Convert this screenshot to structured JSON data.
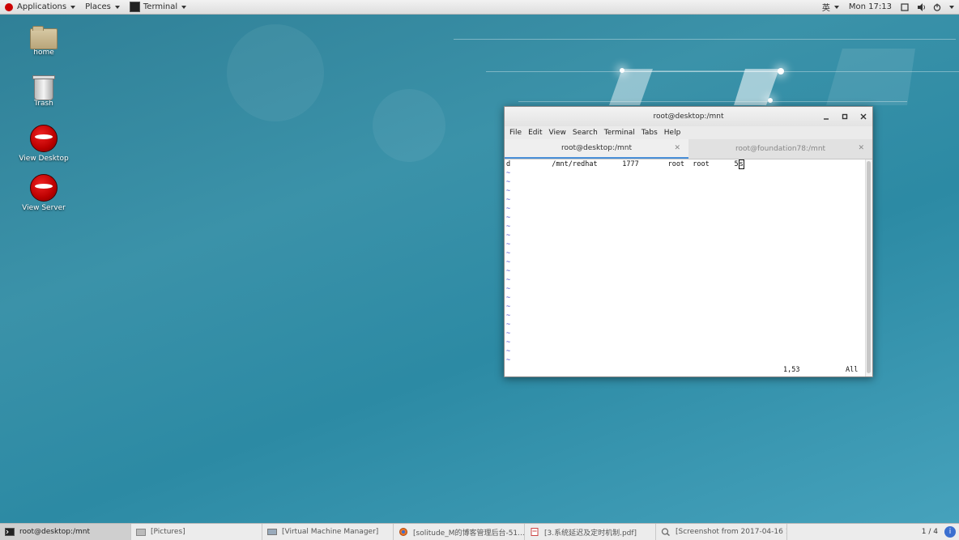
{
  "topbar": {
    "applications_label": "Applications",
    "places_label": "Places",
    "terminal_label": "Terminal",
    "input_method": "英",
    "clock": "Mon 17:13"
  },
  "desktop_icons": [
    {
      "label": "home",
      "icon": "folder-home-icon"
    },
    {
      "label": "Trash",
      "icon": "trash-icon"
    },
    {
      "label": "View Desktop",
      "icon": "redhat-icon"
    },
    {
      "label": "View Server",
      "icon": "redhat-icon"
    }
  ],
  "terminal": {
    "title": "root@desktop:/mnt",
    "menu": [
      "File",
      "Edit",
      "View",
      "Search",
      "Terminal",
      "Tabs",
      "Help"
    ],
    "tabs": [
      {
        "label": "root@desktop:/mnt",
        "active": true
      },
      {
        "label": "root@foundation78:/mnt",
        "active": false
      }
    ],
    "content_line": "d          /mnt/redhat      1777       root  root      5",
    "cursor_char": "s",
    "tilde_rows": 22,
    "status_position": "1,53",
    "status_all": "All"
  },
  "taskbar": {
    "tasks": [
      {
        "label": "root@desktop:/mnt",
        "active": true,
        "icon": "terminal-icon"
      },
      {
        "label": "[Pictures]",
        "active": false,
        "icon": "folder-icon"
      },
      {
        "label": "[Virtual Machine Manager]",
        "active": false,
        "icon": "vm-manager-icon"
      },
      {
        "label": "[solitude_M的博客管理后台-51...",
        "active": false,
        "icon": "firefox-icon"
      },
      {
        "label": "[3.系统延迟及定时机制.pdf]",
        "active": false,
        "icon": "pdf-icon"
      },
      {
        "label": "[Screenshot from 2017-04-16 1...",
        "active": false,
        "icon": "screenshot-icon"
      }
    ],
    "pager": "1 / 4",
    "info_icon": "i"
  },
  "colors": {
    "wallpaper": "#3b92a9",
    "tab_accent": "#4a90d9",
    "vim_tilde": "#4a4acc"
  }
}
